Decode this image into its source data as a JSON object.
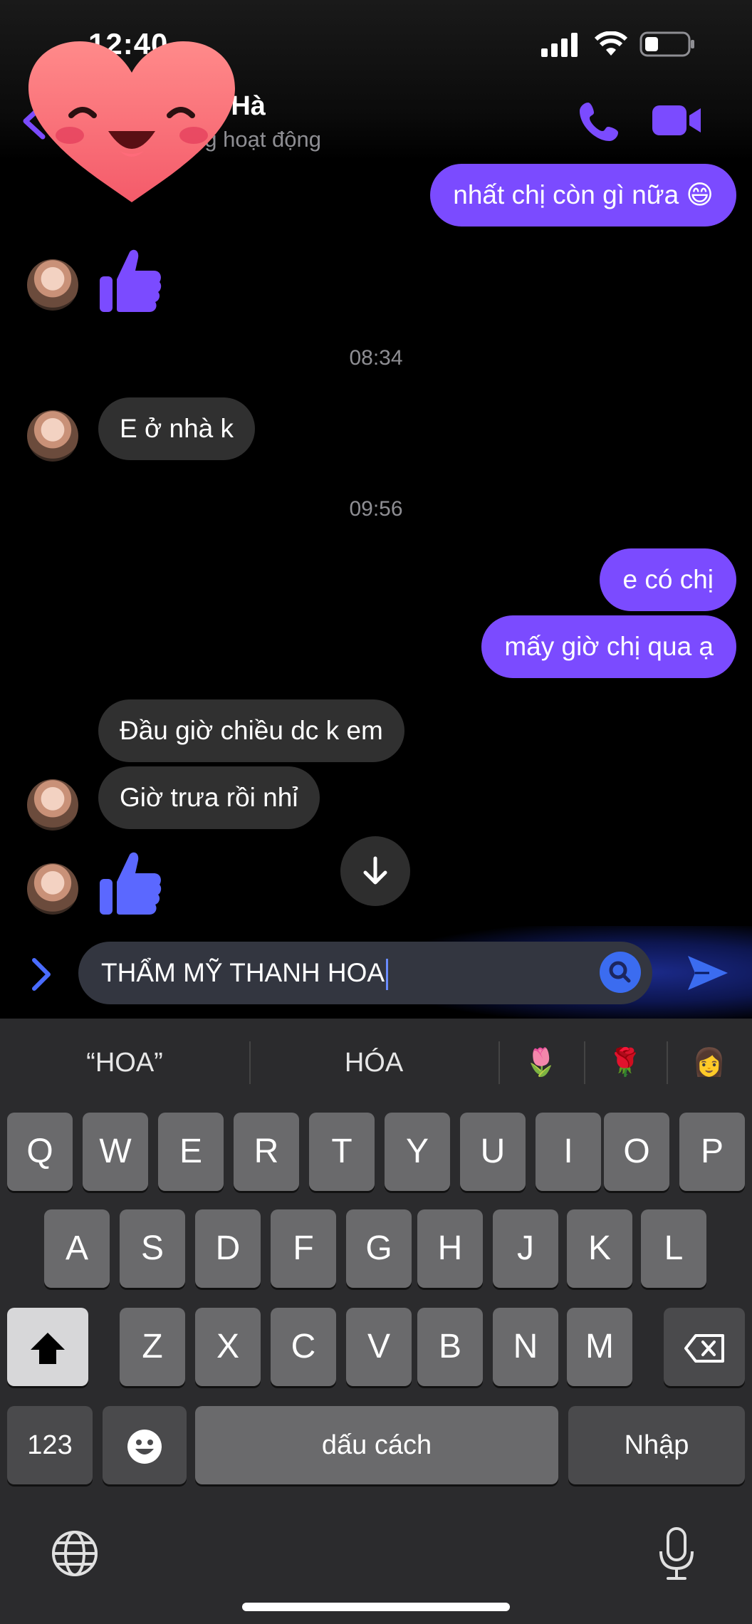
{
  "status_bar": {
    "time": "12:40"
  },
  "header": {
    "contact_name": "m Hà",
    "contact_status": "ng hoạt động"
  },
  "messages": {
    "m1": "nhất chị còn gì nữa 😄",
    "t1": "08:34",
    "m2": "E ở nhà k",
    "t2": "09:56",
    "m3": "e có chị",
    "m4": "mấy giờ chị qua ạ",
    "m5": "Đầu giờ chiều dc k em",
    "m6": "Giờ trưa rồi nhỉ"
  },
  "composer": {
    "text": "THẨM MỸ THANH HOA"
  },
  "keyboard": {
    "suggestions": [
      "“HOA”",
      "HÓA",
      "🌷",
      "🌹",
      "👩"
    ],
    "row1": [
      "Q",
      "W",
      "E",
      "R",
      "T",
      "Y",
      "U",
      "I",
      "O",
      "P"
    ],
    "row2": [
      "A",
      "S",
      "D",
      "F",
      "G",
      "H",
      "J",
      "K",
      "L"
    ],
    "row3": [
      "Z",
      "X",
      "C",
      "V",
      "B",
      "N",
      "M"
    ],
    "numbers": "123",
    "space": "dấu cách",
    "return": "Nhập"
  },
  "colors": {
    "accent": "#7b4bff",
    "incoming": "#303030",
    "send": "#3b6cf0"
  }
}
